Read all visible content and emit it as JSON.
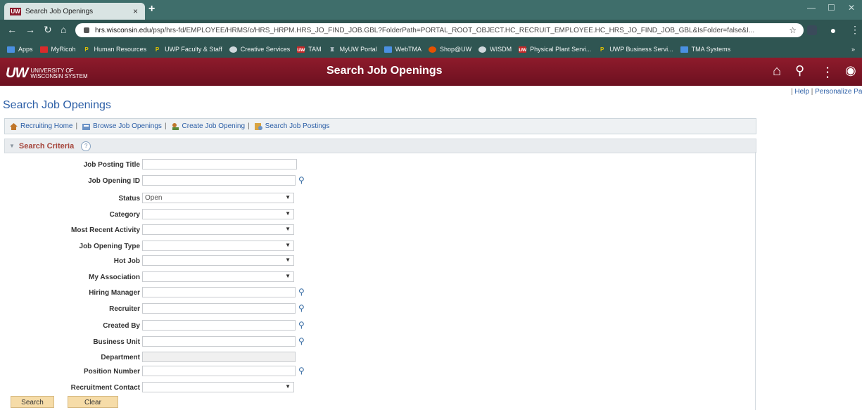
{
  "browser": {
    "tab_title": "Search Job Openings",
    "tab_close": "×",
    "new_tab": "+",
    "url_host": "hrs.wisconsin.edu",
    "url_path": "/psp/hrs-fd/EMPLOYEE/HRMS/c/HRS_HRPM.HRS_JO_FIND_JOB.GBL?FolderPath=PORTAL_ROOT_OBJECT.HC_RECRUIT_EMPLOYEE.HC_HRS_JO_FIND_JOB_GBL&IsFolder=false&I...",
    "bookmarks": [
      {
        "label": "Apps",
        "icon": "apps-grid-icon",
        "color": "#4a90e2"
      },
      {
        "label": "MyRicoh",
        "icon": "ricoh-icon",
        "color": "#d92b2b"
      },
      {
        "label": "Human Resources",
        "icon": "peoplesoft-p-icon",
        "color": "#e0c200"
      },
      {
        "label": "UWP Faculty & Staff",
        "icon": "peoplesoft-p-icon",
        "color": "#e0c200"
      },
      {
        "label": "Creative Services",
        "icon": "globe-icon",
        "color": "#cfd8dc"
      },
      {
        "label": "TAM",
        "icon": "uw-logo-icon",
        "color": "#c62828"
      },
      {
        "label": "MyUW Portal",
        "icon": "myuw-icon",
        "color": "#b0bec5"
      },
      {
        "label": "WebTMA",
        "icon": "page-icon",
        "color": "#4a90e2"
      },
      {
        "label": "Shop@UW",
        "icon": "shop-icon",
        "color": "#e65100"
      },
      {
        "label": "WISDM",
        "icon": "globe-icon",
        "color": "#cfd8dc"
      },
      {
        "label": "Physical Plant Servi...",
        "icon": "uw-logo-icon",
        "color": "#c62828"
      },
      {
        "label": "UWP Business Servi...",
        "icon": "peoplesoft-p-icon",
        "color": "#e0c200"
      },
      {
        "label": "TMA Systems",
        "icon": "page-icon",
        "color": "#4a90e2"
      }
    ],
    "bookmarks_more": "»"
  },
  "header": {
    "logo_mark": "UW",
    "logo_line1": "UNIVERSITY OF",
    "logo_line2": "WISCONSIN SYSTEM",
    "title": "Search Job Openings",
    "accent_color": "#7d1426"
  },
  "top_links": {
    "help": "Help",
    "personalize": "Personalize Pa"
  },
  "page": {
    "title": "Search Job Openings"
  },
  "toolbar": {
    "items": [
      {
        "label": "Recruiting Home",
        "icon": "home-icon"
      },
      {
        "label": "Browse Job Openings",
        "icon": "browse-icon"
      },
      {
        "label": "Create Job Opening",
        "icon": "create-icon"
      },
      {
        "label": "Search Job Postings",
        "icon": "search-postings-icon"
      }
    ],
    "separator": "|"
  },
  "section": {
    "title": "Search Criteria",
    "help": "?"
  },
  "fields": {
    "job_posting_title": {
      "label": "Job Posting Title",
      "value": ""
    },
    "job_opening_id": {
      "label": "Job Opening ID",
      "value": ""
    },
    "status": {
      "label": "Status",
      "value": "Open"
    },
    "category": {
      "label": "Category",
      "value": ""
    },
    "most_recent_activity": {
      "label": "Most Recent Activity",
      "value": ""
    },
    "job_opening_type": {
      "label": "Job Opening Type",
      "value": ""
    },
    "hot_job": {
      "label": "Hot Job",
      "value": ""
    },
    "my_association": {
      "label": "My Association",
      "value": ""
    },
    "hiring_manager": {
      "label": "Hiring Manager",
      "value": ""
    },
    "recruiter": {
      "label": "Recruiter",
      "value": ""
    },
    "created_by": {
      "label": "Created By",
      "value": ""
    },
    "business_unit": {
      "label": "Business Unit",
      "value": ""
    },
    "department": {
      "label": "Department",
      "value": ""
    },
    "position_number": {
      "label": "Position Number",
      "value": ""
    },
    "recruitment_contact": {
      "label": "Recruitment Contact",
      "value": ""
    }
  },
  "buttons": {
    "search": "Search",
    "clear": "Clear"
  },
  "glyphs": {
    "dropdown_arrow": "▼",
    "lookup": "🔍"
  }
}
